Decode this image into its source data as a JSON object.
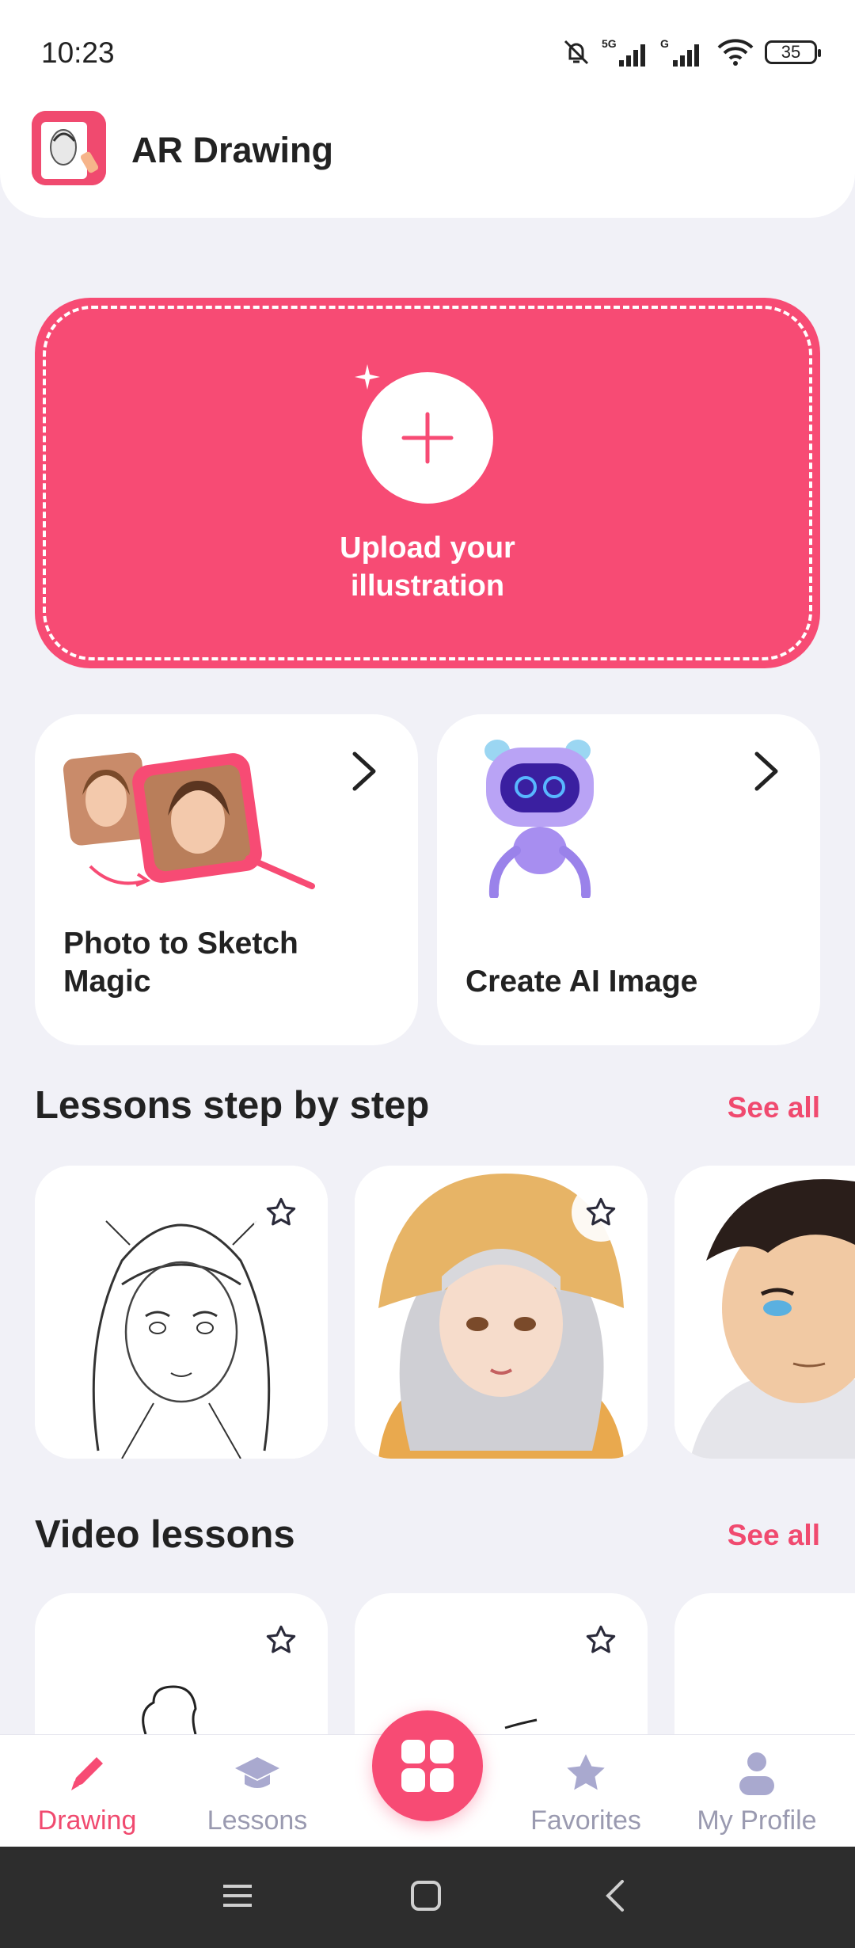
{
  "status": {
    "time": "10:23",
    "battery": "35",
    "network_a": "5G",
    "network_b": "G"
  },
  "header": {
    "title": "AR Drawing",
    "logo": "app-logo"
  },
  "upload": {
    "label": "Upload your\nillustration",
    "icon": "plus-icon"
  },
  "features": [
    {
      "label": "Photo to Sketch\nMagic",
      "icon": "chevron-right-icon"
    },
    {
      "label": "Create AI Image",
      "icon": "chevron-right-icon"
    }
  ],
  "lessons": {
    "title": "Lessons step by step",
    "see_all": "See all"
  },
  "videos": {
    "title": "Video lessons",
    "see_all": "See all"
  },
  "nav": {
    "drawing": "Drawing",
    "lessons": "Lessons",
    "favorites": "Favorites",
    "profile": "My Profile"
  },
  "colors": {
    "accent": "#f74b74",
    "accent_text": "#f04a6f",
    "inactive": "#9a9ab0",
    "background": "#f1f1f7"
  }
}
